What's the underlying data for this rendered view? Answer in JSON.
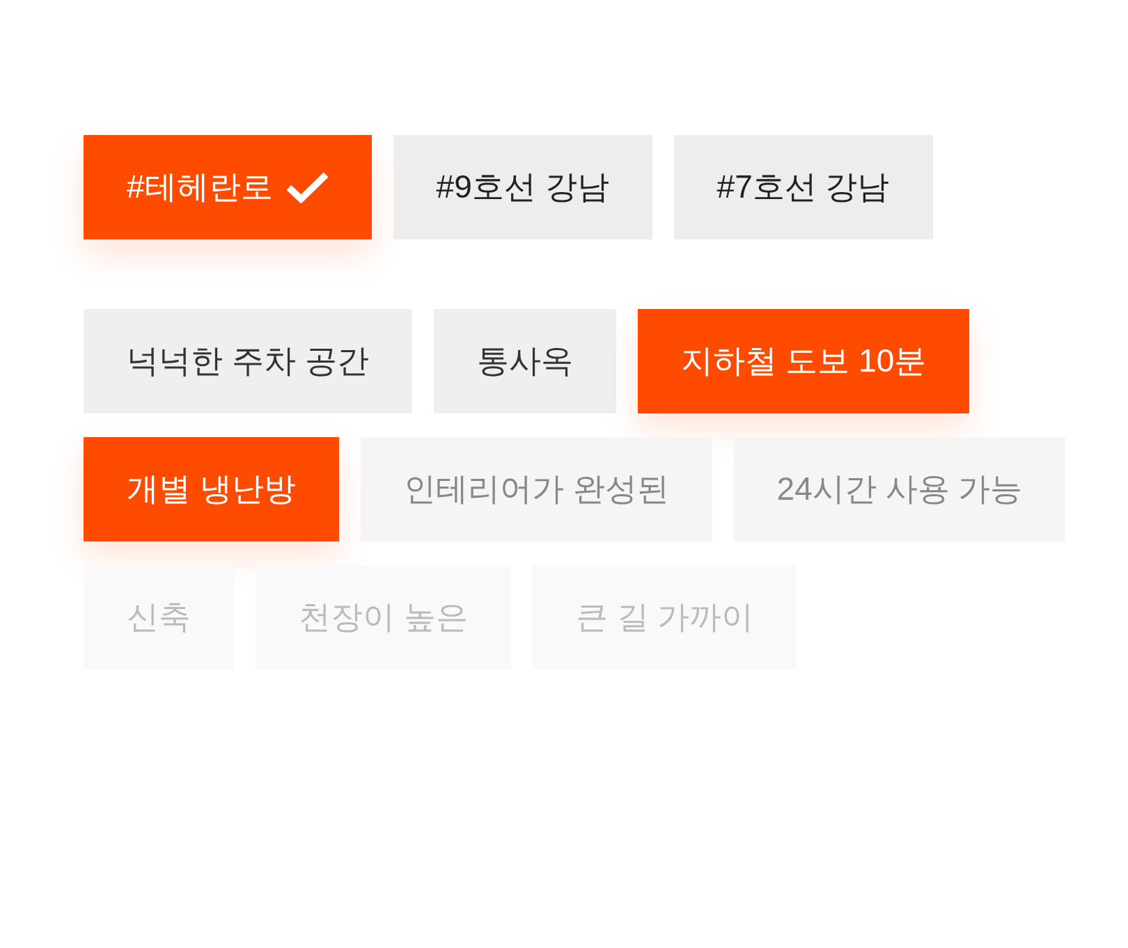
{
  "rows": [
    {
      "kind": "strong",
      "tags": [
        {
          "label": "#테헤란로",
          "selected": true,
          "checked": true
        },
        {
          "label": "#9호선 강남",
          "selected": false,
          "checked": false
        },
        {
          "label": "#7호선 강남",
          "selected": false,
          "checked": false
        }
      ]
    },
    {
      "kind": "normal",
      "tags": [
        {
          "label": "넉넉한 주차 공간",
          "selected": false,
          "checked": false
        },
        {
          "label": "통사옥",
          "selected": false,
          "checked": false
        },
        {
          "label": "지하철 도보 10분",
          "selected": true,
          "checked": false
        }
      ]
    },
    {
      "kind": "muted",
      "tags": [
        {
          "label": "개별 냉난방",
          "selected": true,
          "checked": false
        },
        {
          "label": "인테리어가 완성된",
          "selected": false,
          "checked": false
        },
        {
          "label": "24시간 사용 가능",
          "selected": false,
          "checked": false
        }
      ]
    },
    {
      "kind": "faint",
      "tags": [
        {
          "label": "신축",
          "selected": false,
          "checked": false
        },
        {
          "label": "천장이 높은",
          "selected": false,
          "checked": false
        },
        {
          "label": "큰 길 가까이",
          "selected": false,
          "checked": false
        }
      ]
    }
  ]
}
